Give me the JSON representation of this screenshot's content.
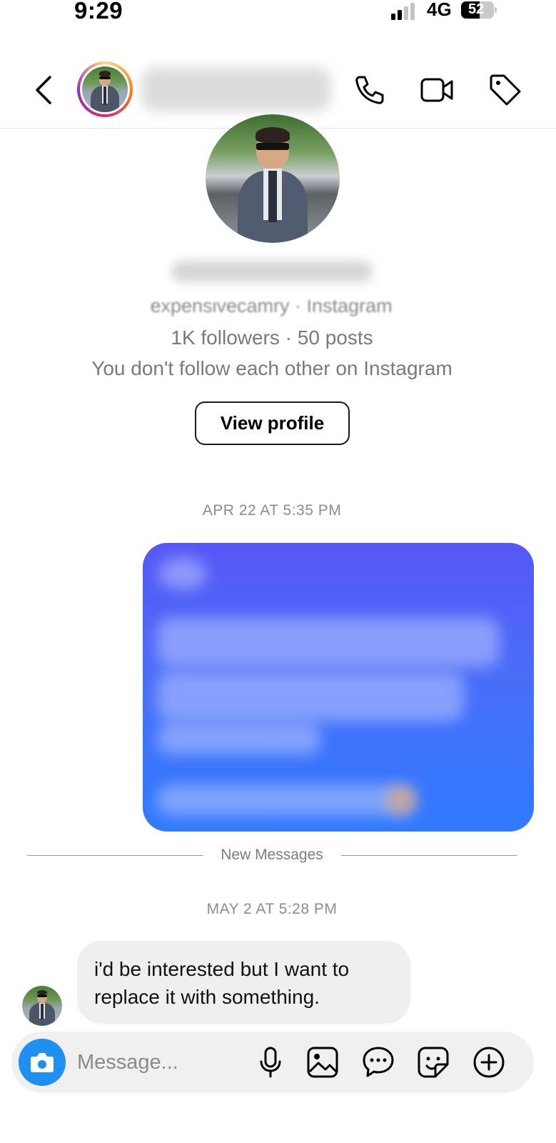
{
  "status_bar": {
    "time": "9:29",
    "network": "4G",
    "battery": "52"
  },
  "header": {
    "contact_name_blurred": ""
  },
  "profile": {
    "handle": "expensivecamry · Instagram",
    "stats": "1K followers · 50 posts",
    "follow_note": "You don't follow each other on Instagram",
    "view_profile_label": "View profile"
  },
  "messages": {
    "timestamp_1": "APR 22 AT 5:35 PM",
    "new_messages_label": "New Messages",
    "timestamp_2": "MAY 2 AT 5:28 PM",
    "received_text": "i'd be interested but I want to replace it with something."
  },
  "composer": {
    "placeholder": "Message..."
  },
  "colors": {
    "accent_blue": "#1f8ff1",
    "bubble_gradient_top": "#5657f6",
    "bubble_gradient_bottom": "#2f7bff"
  },
  "icons": {
    "back": "chevron-left-icon",
    "call": "phone-icon",
    "video": "video-camera-icon",
    "tag": "tag-icon",
    "camera": "camera-icon",
    "mic": "microphone-icon",
    "gallery": "image-icon",
    "chat": "chat-bubble-icon",
    "sticker": "sticker-icon",
    "add": "plus-circle-icon"
  }
}
